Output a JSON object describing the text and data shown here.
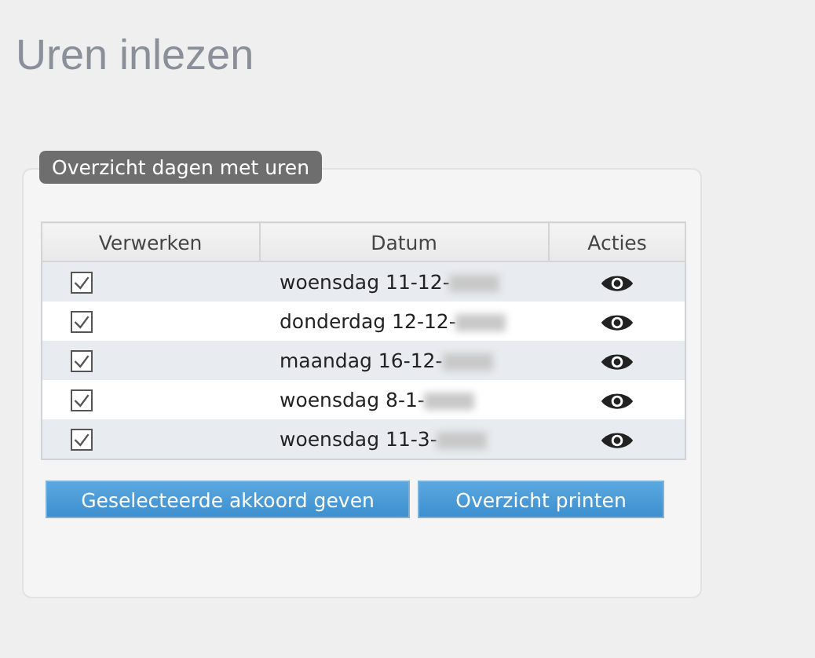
{
  "page_title": "Uren inlezen",
  "panel": {
    "legend": "Overzicht dagen met uren",
    "table": {
      "columns": [
        "Verwerken",
        "Datum",
        "Acties"
      ],
      "rows": [
        {
          "checked": true,
          "date": "woensdag 11-12-"
        },
        {
          "checked": true,
          "date": "donderdag 12-12-"
        },
        {
          "checked": true,
          "date": "maandag 16-12-"
        },
        {
          "checked": true,
          "date": "woensdag 8-1-"
        },
        {
          "checked": true,
          "date": "woensdag 11-3-"
        }
      ]
    },
    "buttons": [
      "Geselecteerde akkoord geven",
      "Overzicht printen"
    ]
  }
}
